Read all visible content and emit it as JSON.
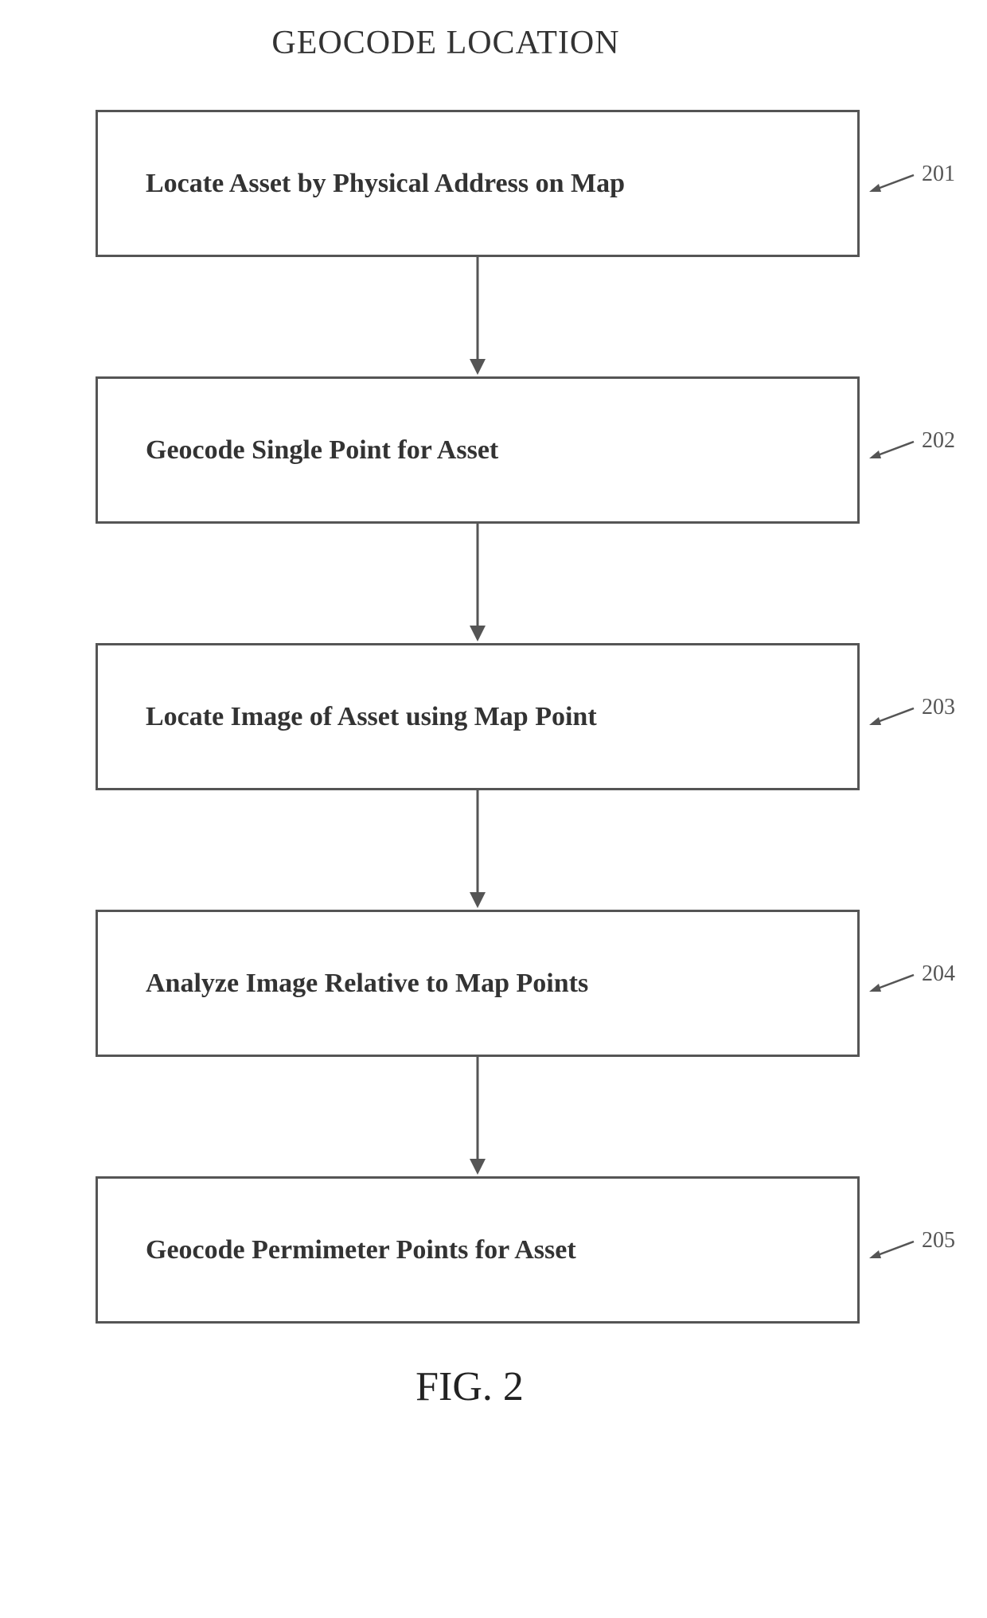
{
  "title": "GEOCODE LOCATION",
  "figure_label": "FIG. 2",
  "steps": [
    {
      "text": "Locate Asset by Physical Address on Map",
      "ref": "201"
    },
    {
      "text": "Geocode Single Point for Asset",
      "ref": "202"
    },
    {
      "text": "Locate Image of Asset using Map Point",
      "ref": "203"
    },
    {
      "text": "Analyze Image Relative to Map Points",
      "ref": "204"
    },
    {
      "text": "Geocode Permimeter Points for Asset",
      "ref": "205"
    }
  ]
}
